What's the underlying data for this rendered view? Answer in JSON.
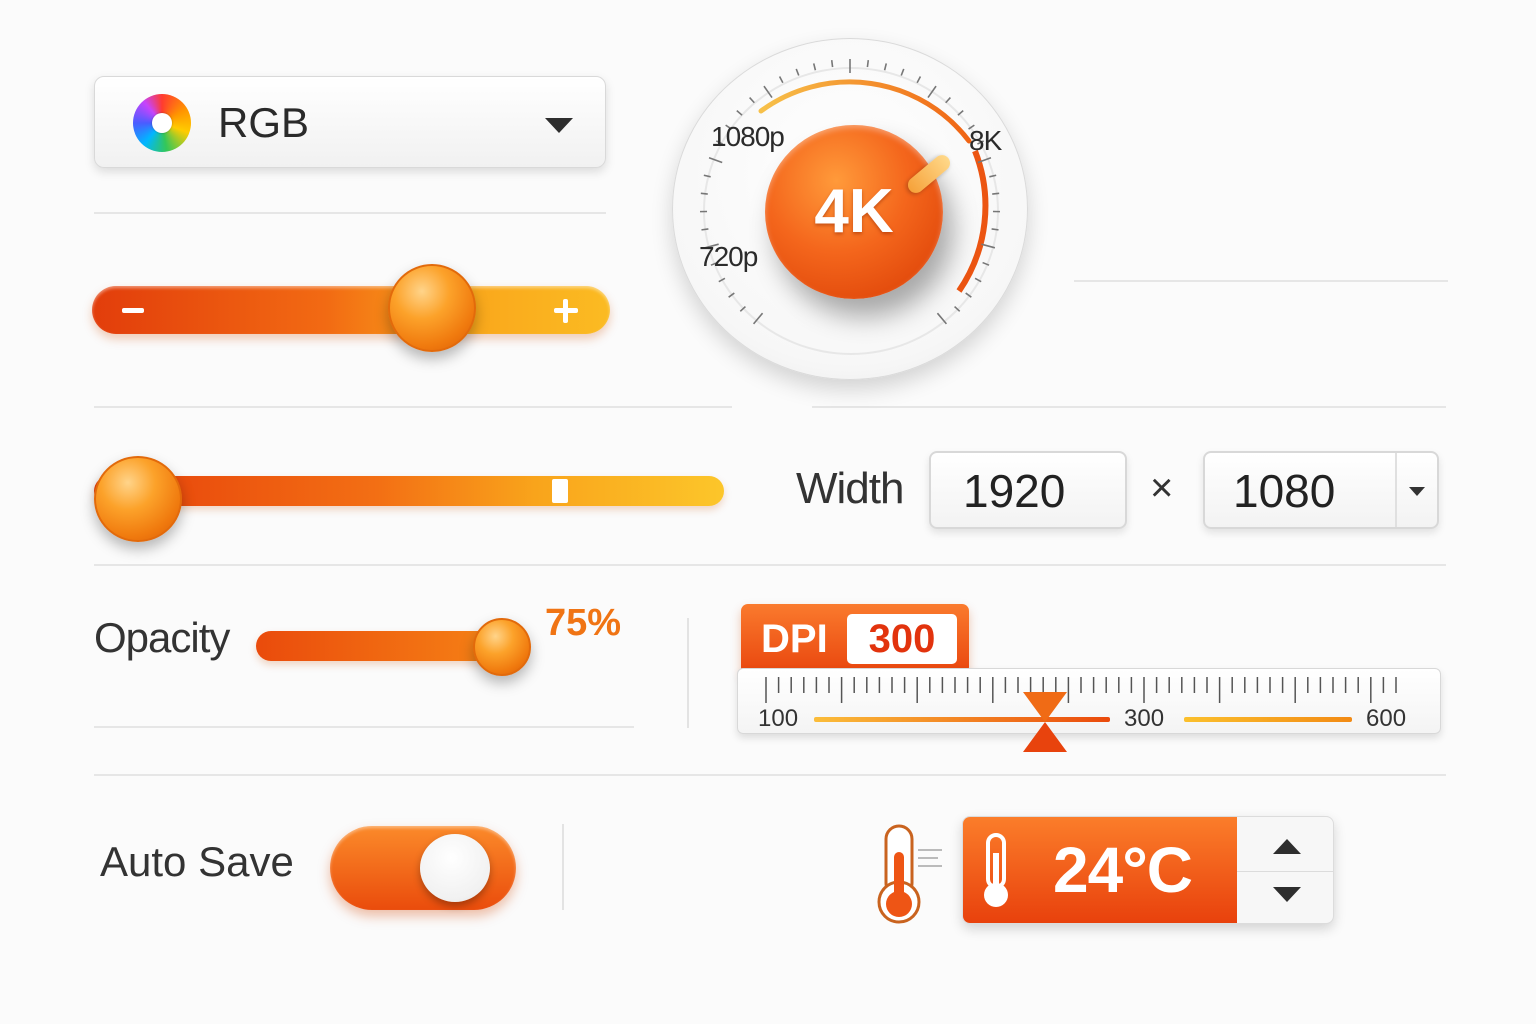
{
  "color_mode": {
    "label": "RGB",
    "icon": "color-wheel-icon"
  },
  "zoom_slider": {
    "minus_icon": "minus-icon",
    "plus_icon": "plus-icon",
    "value_fraction": 0.65
  },
  "resolution_dial": {
    "value": "4K",
    "labels": {
      "low": "720p",
      "mid": "1080p",
      "high": "8K"
    }
  },
  "scrub_slider": {
    "value_fraction": 0.0,
    "marker_fraction": 0.74
  },
  "size": {
    "width_label": "Width",
    "width": "1920",
    "times": "×",
    "height": "1080"
  },
  "opacity": {
    "label": "Opacity",
    "value": "75%",
    "value_fraction": 0.9
  },
  "dpi": {
    "label": "DPI",
    "value": "300",
    "scale": {
      "min": "100",
      "mid": "300",
      "max": "600"
    }
  },
  "auto_save": {
    "label": "Auto Save",
    "on": true
  },
  "temperature": {
    "value": "24°C",
    "icon": "thermometer-icon"
  },
  "colors": {
    "accent": "#f26a13",
    "accent_dark": "#e2330d",
    "accent_light": "#fbbb22"
  }
}
